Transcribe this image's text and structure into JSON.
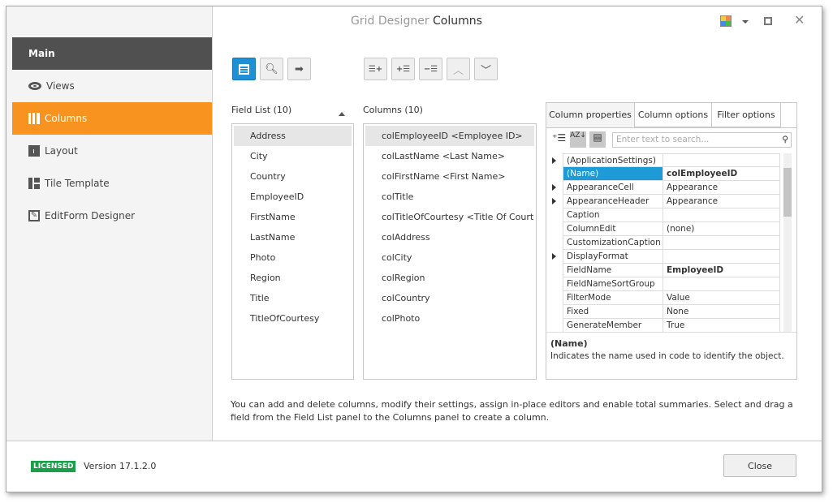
{
  "window": {
    "title_prefix": "Grid Designer",
    "title": "Columns"
  },
  "sidebar": {
    "items": [
      {
        "label": "Main",
        "icon": "none"
      },
      {
        "label": "Views",
        "icon": "eye-icon"
      },
      {
        "label": "Columns",
        "icon": "columns-icon"
      },
      {
        "label": "Layout",
        "icon": "layout-icon"
      },
      {
        "label": "Tile Template",
        "icon": "layout-icon"
      },
      {
        "label": "EditForm Designer",
        "icon": "edit-form-icon"
      }
    ],
    "selected": "Columns",
    "accent": "#f7931e"
  },
  "field_list": {
    "label": "Field List (10)",
    "items": [
      "Address",
      "City",
      "Country",
      "EmployeeID",
      "FirstName",
      "LastName",
      "Photo",
      "Region",
      "Title",
      "TitleOfCourtesy"
    ]
  },
  "columns": {
    "label": "Columns (10)",
    "items": [
      "colEmployeeID <Employee ID>",
      "colLastName <Last Name>",
      "colFirstName <First Name>",
      "colTitle",
      "colTitleOfCourtesy <Title Of Courtesy>",
      "colAddress",
      "colCity",
      "colRegion",
      "colCountry",
      "colPhoto"
    ]
  },
  "properties": {
    "tabs": [
      "Column properties",
      "Column options",
      "Filter options"
    ],
    "search_placeholder": "Enter text to search...",
    "rows": [
      {
        "k": "(ApplicationSettings)",
        "v": "",
        "ex": true
      },
      {
        "k": "(Name)",
        "v": "colEmployeeID",
        "bold": true,
        "sel": true
      },
      {
        "k": "AppearanceCell",
        "v": "Appearance",
        "ex": true
      },
      {
        "k": "AppearanceHeader",
        "v": "Appearance",
        "ex": true
      },
      {
        "k": "Caption",
        "v": ""
      },
      {
        "k": "ColumnEdit",
        "v": "(none)"
      },
      {
        "k": "CustomizationCaption",
        "v": ""
      },
      {
        "k": "DisplayFormat",
        "v": "",
        "ex": true
      },
      {
        "k": "FieldName",
        "v": "EmployeeID",
        "bold": true
      },
      {
        "k": "FieldNameSortGroup",
        "v": ""
      },
      {
        "k": "FilterMode",
        "v": "Value"
      },
      {
        "k": "Fixed",
        "v": "None"
      },
      {
        "k": "GenerateMember",
        "v": "True"
      }
    ],
    "desc_title": "(Name)",
    "desc_text": "Indicates the name used in code to identify the object."
  },
  "hint": "You can add and delete columns, modify their settings, assign in-place editors and enable total summaries. Select and drag a field from the Field List panel to the Columns panel to create a column.",
  "footer": {
    "badge": "LICENSED",
    "version": "Version 17.1.2.0",
    "close": "Close"
  }
}
